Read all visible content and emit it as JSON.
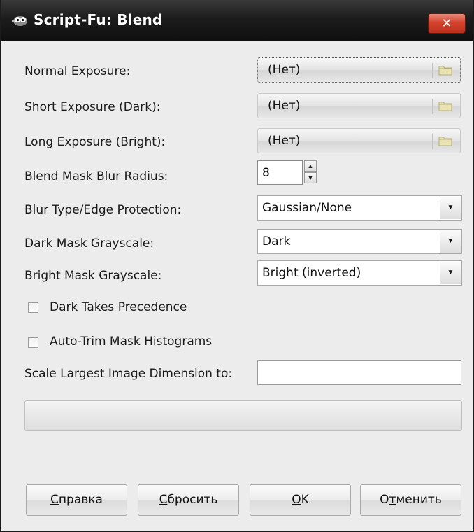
{
  "window": {
    "title": "Script-Fu: Blend",
    "close_glyph": "✕"
  },
  "fields": {
    "normal_exposure": {
      "label": "Normal Exposure:",
      "value": "(Нет)"
    },
    "short_exposure": {
      "label": "Short Exposure (Dark):",
      "value": "(Нет)"
    },
    "long_exposure": {
      "label": "Long Exposure (Bright):",
      "value": "(Нет)"
    },
    "blur_radius": {
      "label": "Blend Mask Blur Radius:",
      "value": "8"
    },
    "blur_type": {
      "label": "Blur Type/Edge Protection:",
      "value": "Gaussian/None"
    },
    "dark_mask": {
      "label": "Dark Mask Grayscale:",
      "value": "Dark"
    },
    "bright_mask": {
      "label": "Bright Mask Grayscale:",
      "value": "Bright (inverted)"
    },
    "dark_precedence": {
      "label": "Dark Takes Precedence",
      "checked": false
    },
    "auto_trim": {
      "label": "Auto-Trim Mask Histograms",
      "checked": false
    },
    "scale_dimension": {
      "label": "Scale Largest Image Dimension to:",
      "value": ""
    }
  },
  "buttons": {
    "help": {
      "mnemonic": "С",
      "rest": "правка"
    },
    "reset": {
      "mnemonic": "С",
      "rest": "бросить"
    },
    "ok": {
      "mnemonic": "O",
      "rest": "K"
    },
    "cancel": {
      "prefix": "О",
      "mnemonic": "т",
      "rest": "менить"
    }
  },
  "icons": {
    "app": "gimp-icon",
    "folder": "folder-icon",
    "spin_up": "▲",
    "spin_down": "▼",
    "combo_arrow": "▼"
  },
  "colors": {
    "titlebar": "#1c1c1c",
    "close_button": "#d4432d",
    "dialog_bg": "#ececec"
  }
}
